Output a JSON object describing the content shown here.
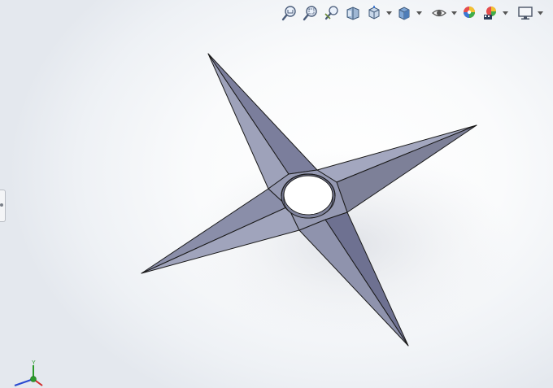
{
  "toolbar": {
    "items": [
      {
        "icon": "zoom-to-fit-icon"
      },
      {
        "icon": "zoom-to-area-icon"
      },
      {
        "icon": "previous-view-icon"
      },
      {
        "icon": "section-view-icon"
      },
      {
        "icon": "view-orientation-icon",
        "dropdown": true
      },
      {
        "icon": "display-style-icon",
        "dropdown": true
      },
      {
        "icon": "hide-show-items-icon",
        "dropdown": true
      },
      {
        "icon": "edit-appearance-icon"
      },
      {
        "icon": "apply-scene-icon",
        "dropdown": true
      },
      {
        "icon": "view-settings-icon",
        "dropdown": true
      }
    ]
  },
  "model": {
    "name": "shuriken-four-point-star",
    "face_color": "#9da1b8",
    "shade_color": "#6e7191",
    "edge_color": "#1a1a1a"
  },
  "triad": {
    "y_label": "Y",
    "colors": {
      "x": "#d02a2a",
      "y": "#2a9a2a",
      "z": "#2a4ad0"
    }
  }
}
